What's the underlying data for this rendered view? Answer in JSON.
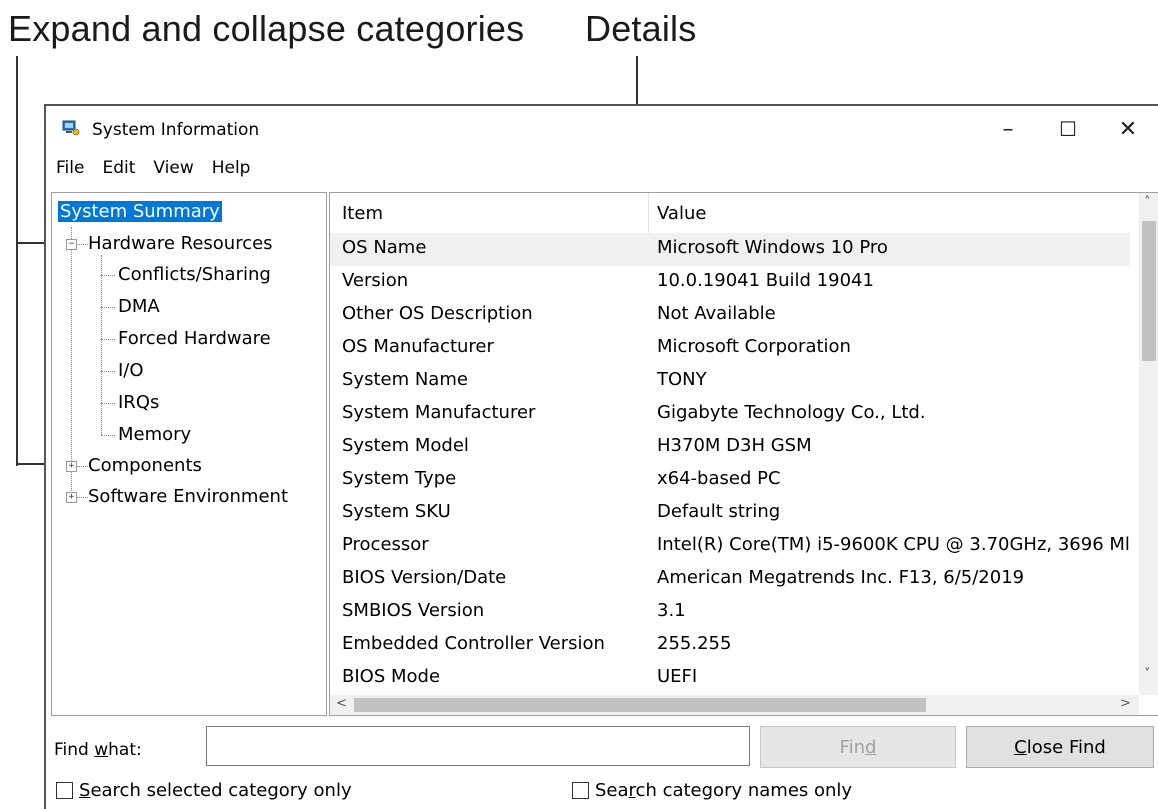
{
  "callouts": {
    "left": "Expand and collapse categories",
    "right": "Details"
  },
  "window": {
    "title": "System Information",
    "minimize_glyph": "–",
    "maximize_glyph": "☐",
    "close_glyph": "✕"
  },
  "menu": [
    "File",
    "Edit",
    "View",
    "Help"
  ],
  "tree": {
    "root": "System Summary",
    "hardware": "Hardware Resources",
    "hardware_children": [
      "Conflicts/Sharing",
      "DMA",
      "Forced Hardware",
      "I/O",
      "IRQs",
      "Memory"
    ],
    "components": "Components",
    "software": "Software Environment"
  },
  "details": {
    "headers": {
      "item": "Item",
      "value": "Value"
    },
    "rows": [
      {
        "item": "OS Name",
        "value": "Microsoft Windows 10 Pro"
      },
      {
        "item": "Version",
        "value": "10.0.19041 Build 19041"
      },
      {
        "item": "Other OS Description",
        "value": "Not Available"
      },
      {
        "item": "OS Manufacturer",
        "value": "Microsoft Corporation"
      },
      {
        "item": "System Name",
        "value": "TONY"
      },
      {
        "item": "System Manufacturer",
        "value": "Gigabyte Technology Co., Ltd."
      },
      {
        "item": "System Model",
        "value": "H370M D3H GSM"
      },
      {
        "item": "System Type",
        "value": "x64-based PC"
      },
      {
        "item": "System SKU",
        "value": "Default string"
      },
      {
        "item": "Processor",
        "value": "Intel(R) Core(TM) i5-9600K CPU @ 3.70GHz, 3696 Ml"
      },
      {
        "item": "BIOS Version/Date",
        "value": "American Megatrends Inc. F13, 6/5/2019"
      },
      {
        "item": "SMBIOS Version",
        "value": "3.1"
      },
      {
        "item": "Embedded Controller Version",
        "value": "255.255"
      },
      {
        "item": "BIOS Mode",
        "value": "UEFI"
      }
    ]
  },
  "find": {
    "label_pre": "Find ",
    "label_key": "w",
    "label_post": "hat:",
    "input_value": "",
    "find_pre": "Fin",
    "find_key": "d",
    "close_key": "C",
    "close_post": "lose Find",
    "opt1_key": "S",
    "opt1_post": "earch selected category only",
    "opt2_pre": "Sea",
    "opt2_key": "r",
    "opt2_post": "ch category names only"
  }
}
